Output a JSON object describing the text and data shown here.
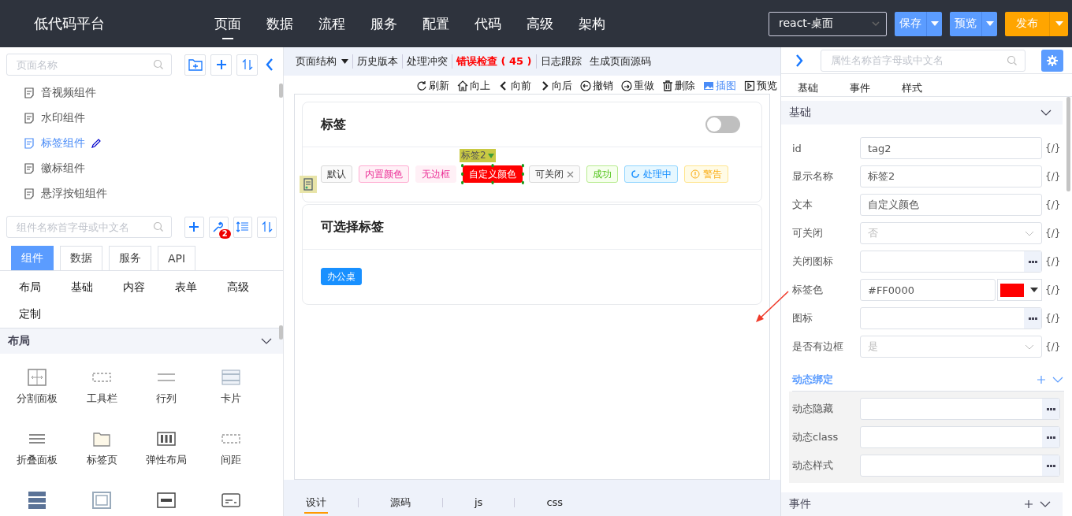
{
  "header": {
    "logo": "低代码平台",
    "nav": [
      {
        "label": "页面",
        "selected": true
      },
      {
        "label": "数据",
        "selected": false
      },
      {
        "label": "流程",
        "selected": false
      },
      {
        "label": "服务",
        "selected": false
      },
      {
        "label": "配置",
        "selected": false
      },
      {
        "label": "代码",
        "selected": false
      },
      {
        "label": "高级",
        "selected": false
      },
      {
        "label": "架构",
        "selected": false
      }
    ],
    "platform_select": "react-桌面",
    "buttons": [
      {
        "label": "保存",
        "kind": "primary"
      },
      {
        "label": "预览",
        "kind": "primary"
      },
      {
        "label": "发布",
        "kind": "warning"
      }
    ]
  },
  "pages": {
    "search_placeholder": "页面名称",
    "items": [
      {
        "label": "音视频组件",
        "selected": false
      },
      {
        "label": "水印组件",
        "selected": false
      },
      {
        "label": "标签组件",
        "selected": true
      },
      {
        "label": "徽标组件",
        "selected": false
      },
      {
        "label": "悬浮按钮组件",
        "selected": false
      }
    ]
  },
  "components": {
    "search_placeholder": "组件名称首字母或中文名",
    "badge": "2",
    "tabs": [
      {
        "label": "组件",
        "selected": true
      },
      {
        "label": "数据",
        "selected": false
      },
      {
        "label": "服务",
        "selected": false
      },
      {
        "label": "API",
        "selected": false
      }
    ],
    "categories": [
      "布局",
      "基础",
      "内容",
      "表单",
      "高级",
      "定制"
    ],
    "section": "布局",
    "items": [
      "分割面板",
      "工具栏",
      "行列",
      "卡片",
      "折叠面板",
      "标签页",
      "弹性布局",
      "间距"
    ]
  },
  "designer": {
    "menu": [
      {
        "label": "页面结构",
        "kind": "dropdown"
      },
      {
        "label": "历史版本",
        "kind": "plain"
      },
      {
        "label": "处理冲突",
        "kind": "plain"
      },
      {
        "label": "错误检查 ( 45 )",
        "kind": "error"
      },
      {
        "label": "日志跟踪",
        "kind": "plain"
      },
      {
        "label": "生成页面源码",
        "kind": "plain"
      }
    ],
    "toolbar": [
      {
        "label": "刷新",
        "active": false
      },
      {
        "label": "向上",
        "active": false
      },
      {
        "label": "向前",
        "active": false
      },
      {
        "label": "向后",
        "active": false
      },
      {
        "label": "撤销",
        "active": false
      },
      {
        "label": "重做",
        "active": false
      },
      {
        "label": "删除",
        "active": false
      },
      {
        "label": "插图",
        "active": true
      },
      {
        "label": "预览",
        "active": false
      }
    ],
    "cards": [
      {
        "title": "标签",
        "switch": {
          "on": false
        },
        "tags": [
          {
            "label": "默认",
            "kind": "default",
            "selected": false
          },
          {
            "label": "内置颜色",
            "kind": "pink",
            "selected": false
          },
          {
            "label": "无边框",
            "kind": "borderless",
            "selected": false
          },
          {
            "label": "自定义颜色",
            "kind": "custom",
            "color": "#ff0000",
            "selected": true,
            "selection_label": "标签2"
          },
          {
            "label": "可关闭",
            "kind": "closable",
            "selected": false
          },
          {
            "label": "成功",
            "kind": "success",
            "selected": false
          },
          {
            "label": "处理中",
            "kind": "processing",
            "selected": false
          },
          {
            "label": "警告",
            "kind": "warning",
            "selected": false
          }
        ]
      },
      {
        "title": "可选择标签",
        "tags": [
          {
            "label": "办公桌",
            "kind": "checked",
            "selected": false
          }
        ]
      }
    ],
    "bottom_tabs": [
      {
        "label": "设计",
        "selected": true
      },
      {
        "label": "源码",
        "selected": false
      },
      {
        "label": "js",
        "selected": false
      },
      {
        "label": "css",
        "selected": false
      }
    ]
  },
  "properties": {
    "search_placeholder": "属性名称首字母或中文名",
    "tabs": [
      "基础",
      "事件",
      "样式"
    ],
    "basic": {
      "title": "基础",
      "rows": [
        {
          "label": "id",
          "kind": "input",
          "value": "tag2",
          "binding": "{/}"
        },
        {
          "label": "显示名称",
          "kind": "input",
          "value": "标签2",
          "binding": "{/}"
        },
        {
          "label": "文本",
          "kind": "input",
          "value": "自定义颜色",
          "binding": "{/}"
        },
        {
          "label": "可关闭",
          "kind": "select",
          "value": "否",
          "disabled": true,
          "binding": "{/}"
        },
        {
          "label": "关闭图标",
          "kind": "picker",
          "binding": "{/}"
        },
        {
          "label": "标签色",
          "kind": "color",
          "value": "#FF0000",
          "color": "#ff0000",
          "binding": "{/}"
        },
        {
          "label": "图标",
          "kind": "picker",
          "binding": "{/}"
        },
        {
          "label": "是否有边框",
          "kind": "select",
          "value": "是",
          "disabled": true,
          "binding": "{/}"
        }
      ]
    },
    "dynamic": {
      "title": "动态绑定",
      "rows": [
        {
          "label": "动态隐藏"
        },
        {
          "label": "动态class"
        },
        {
          "label": "动态样式"
        }
      ]
    },
    "events": {
      "title": "事件"
    }
  }
}
